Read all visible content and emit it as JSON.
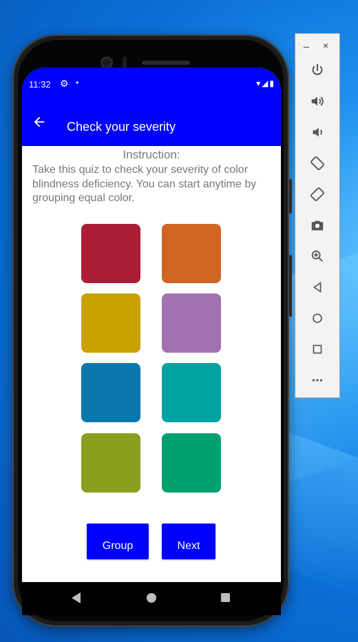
{
  "status_bar": {
    "time": "11:32",
    "gear": "⚙",
    "dot": "•",
    "right": "▾◢▮"
  },
  "app_bar": {
    "title": "Check your severity",
    "back_icon": "arrow-back-icon"
  },
  "instruction": {
    "title": "Instruction:",
    "text": "Take this quiz to check your severity of color blindness deficiency. You can start anytime by grouping equal color."
  },
  "swatches": [
    {
      "color": "#ab1e35"
    },
    {
      "color": "#d06422"
    },
    {
      "color": "#c9a200"
    },
    {
      "color": "#a271b0"
    },
    {
      "color": "#0a78ad"
    },
    {
      "color": "#00a3a2"
    },
    {
      "color": "#8a9f1d"
    },
    {
      "color": "#00a06e"
    }
  ],
  "buttons": {
    "group": "Group",
    "next": "Next"
  },
  "colors": {
    "accent": "#0000ff",
    "text_gray": "#777777"
  },
  "emulator_toolbar": {
    "minimize": "–",
    "close": "×",
    "items": [
      "power-icon",
      "volume-up-icon",
      "volume-down-icon",
      "rotate-left-icon",
      "rotate-right-icon",
      "camera-icon",
      "zoom-icon",
      "back-nav-icon",
      "home-nav-icon",
      "overview-nav-icon",
      "more-icon"
    ]
  }
}
